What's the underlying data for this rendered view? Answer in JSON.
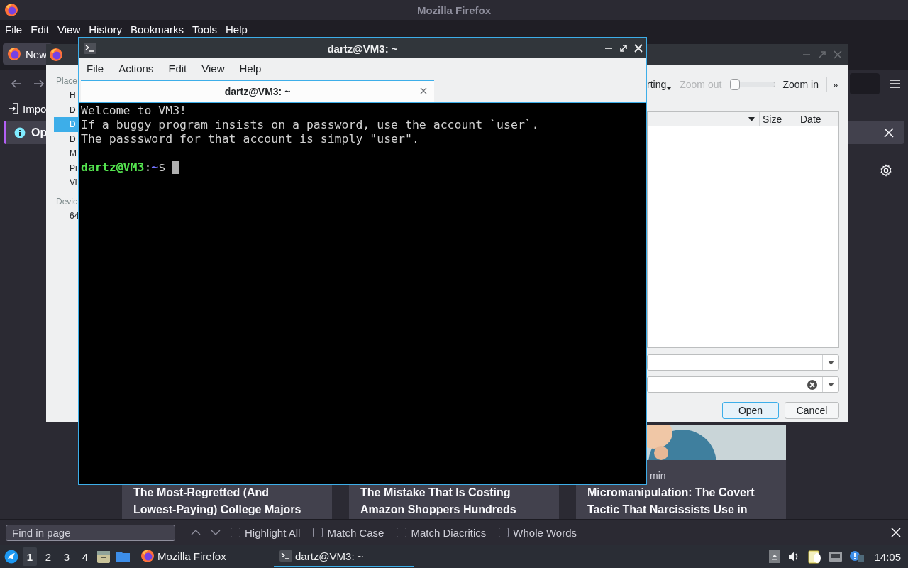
{
  "firefox": {
    "title": "Mozilla Firefox",
    "menu": [
      "File",
      "Edit",
      "View",
      "History",
      "Bookmarks",
      "Tools",
      "Help"
    ],
    "tabs": [
      {
        "label": "New",
        "selected": true
      }
    ],
    "bookmarks": [
      {
        "label": "Impo"
      }
    ],
    "notification": {
      "text": "Op"
    },
    "articles": [
      {
        "title": "The Most-Regretted (And Lowest-Paying) College Majors"
      },
      {
        "title": "The Mistake That Is Costing Amazon Shoppers Hundreds"
      },
      {
        "meta": "min",
        "title": "Micromanipulation: The Covert Tactic That Narcissists Use in"
      }
    ],
    "find_bar": {
      "placeholder": "Find in page",
      "options": [
        {
          "label": "Highlight All",
          "checked": false
        },
        {
          "label": "Match Case",
          "checked": false
        },
        {
          "label": "Match Diacritics",
          "checked": false
        },
        {
          "label": "Whole Words",
          "checked": false
        }
      ]
    }
  },
  "file_dialog": {
    "toolbar": {
      "sorting": "rting",
      "zoom_out": {
        "label": "Zoom out",
        "disabled": true
      },
      "zoom": {
        "level": 0
      },
      "zoom_in": "Zoom in",
      "more": "»"
    },
    "sidebar": [
      {
        "heading": "Place",
        "items": [
          {
            "label": "H",
            "selected": false
          },
          {
            "label": "D",
            "selected": false
          },
          {
            "label": "D",
            "selected": true
          },
          {
            "label": "D",
            "selected": false
          },
          {
            "label": "M",
            "selected": false
          },
          {
            "label": "Pi",
            "selected": false
          },
          {
            "label": "Vi",
            "selected": false
          }
        ]
      },
      {
        "heading": "Devic",
        "items": [
          {
            "label": "64",
            "selected": false
          }
        ]
      }
    ],
    "columns": [
      "Size",
      "Date"
    ],
    "buttons": [
      {
        "label": "Open",
        "default": true
      },
      {
        "label": "Cancel",
        "default": false
      }
    ]
  },
  "terminal": {
    "title": "dartz@VM3: ~",
    "menu": [
      "File",
      "Actions",
      "Edit",
      "View",
      "Help"
    ],
    "tab": {
      "label": "dartz@VM3: ~",
      "selected": true
    },
    "lines": [
      "Welcome to VM3!",
      "If a buggy program insists on a password, use the account `user`.",
      "The passsword for that account is simply \"user\"."
    ],
    "prompt": [
      {
        "text": "dartz@VM3",
        "color": "#54e34f"
      },
      {
        "text": ":",
        "color": "#d0d0d0"
      },
      {
        "text": "~",
        "color": "#7373ff"
      },
      {
        "text": "$",
        "color": "#d0d0d0"
      }
    ]
  },
  "taskbar": {
    "workspaces": [
      {
        "label": "1",
        "selected": true
      },
      {
        "label": "2",
        "selected": false
      },
      {
        "label": "3",
        "selected": false
      },
      {
        "label": "4",
        "selected": false
      }
    ],
    "tasks": [
      {
        "label": "Mozilla Firefox",
        "kind": "browser",
        "selected": false
      },
      {
        "label": "dartz@VM3: ~",
        "kind": "terminal",
        "selected": true
      }
    ],
    "clock": "14:05"
  }
}
